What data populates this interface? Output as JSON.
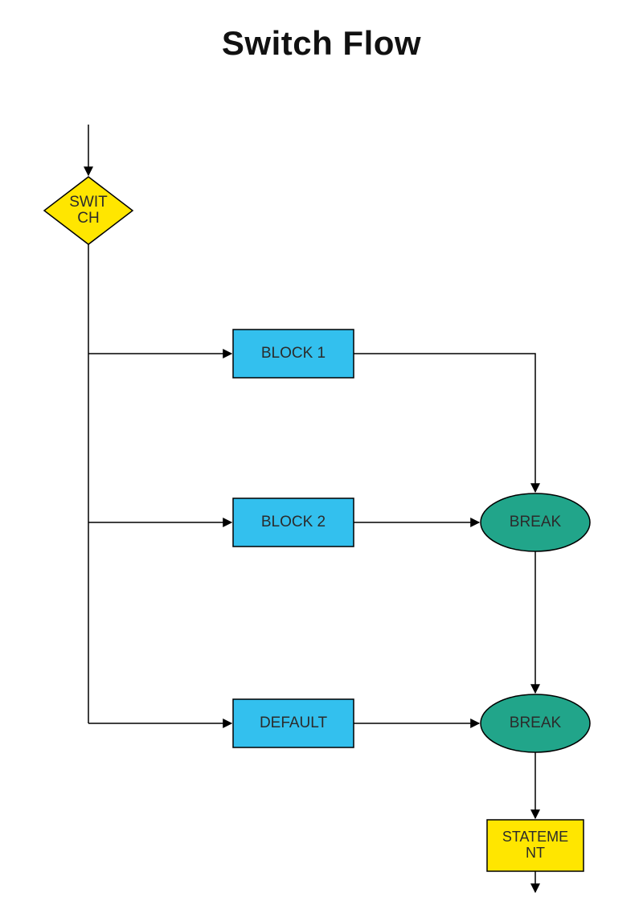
{
  "title": "Switch Flow",
  "nodes": {
    "switch_l1": "SWIT",
    "switch_l2": "CH",
    "block1": "BLOCK 1",
    "block2": "BLOCK 2",
    "default": "DEFAULT",
    "break1": "BREAK",
    "break2": "BREAK",
    "statement_l1": "STATEME",
    "statement_l2": "NT"
  },
  "colors": {
    "diamond_fill": "#ffe600",
    "rect_block_fill": "#33c0ee",
    "ellipse_fill": "#21a58a",
    "statement_fill": "#ffe600",
    "stroke": "#000000"
  }
}
